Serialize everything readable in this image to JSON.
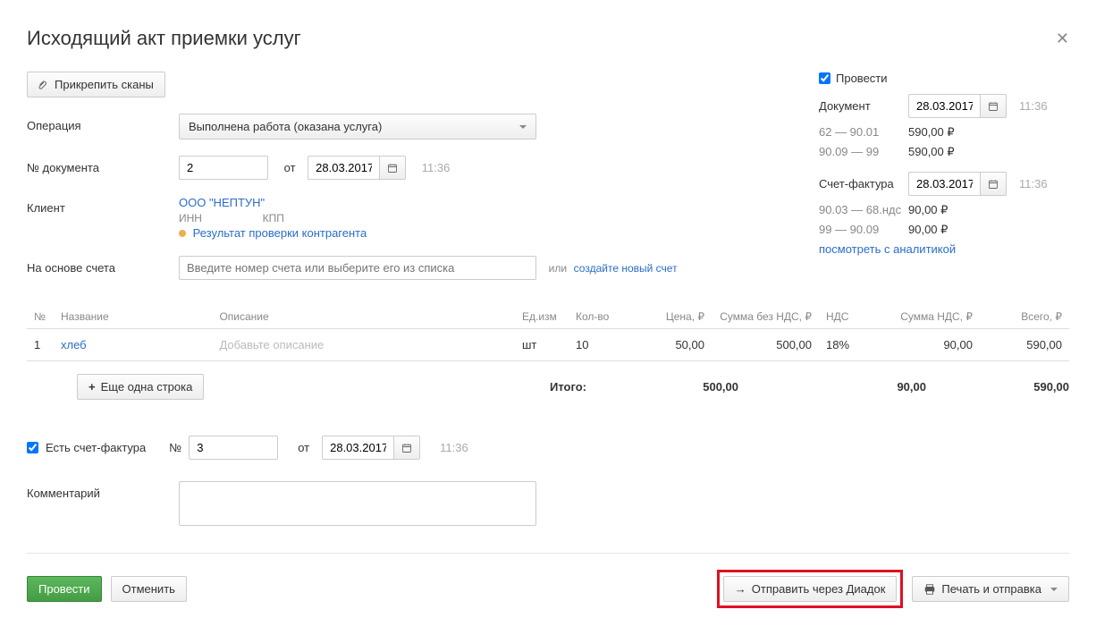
{
  "header": {
    "title": "Исходящий акт приемки услуг",
    "attach_scans": "Прикрепить сканы"
  },
  "left": {
    "operation_label": "Операция",
    "operation_value": "Выполнена работа (оказана услуга)",
    "doc_no_label": "№ документа",
    "doc_no": "2",
    "from_label": "от",
    "doc_date": "28.03.2017",
    "doc_time": "11:36",
    "client_label": "Клиент",
    "client_name": "ООО \"НЕПТУН\"",
    "inn_label": "ИНН",
    "kpp_label": "КПП",
    "check_result": "Результат проверки контрагента",
    "based_on_label": "На основе счета",
    "based_on_placeholder": "Введите номер счета или выберите его из списка",
    "or_label": "или",
    "create_new_invoice": "создайте новый счет"
  },
  "right": {
    "process_label": "Провести",
    "document_label": "Документ",
    "document_date": "28.03.2017",
    "document_time": "11:36",
    "acct1_left": "62 — 90.01",
    "acct1_right": "590,00 ₽",
    "acct2_left": "90.09 — 99",
    "acct2_right": "590,00 ₽",
    "invoice_label": "Счет-фактура",
    "invoice_date": "28.03.2017",
    "invoice_time": "11:36",
    "acct3_left": "90.03 — 68.ндс",
    "acct3_right": "90,00 ₽",
    "acct4_left": "99 — 90.09",
    "acct4_right": "90,00 ₽",
    "analytics": "посмотреть с аналитикой"
  },
  "table": {
    "headers": {
      "num": "№",
      "name": "Название",
      "desc": "Описание",
      "unit": "Ед.изм",
      "qty": "Кол-во",
      "price": "Цена, ₽",
      "sum_no_vat": "Сумма без НДС, ₽",
      "vat": "НДС",
      "vat_sum": "Сумма НДС, ₽",
      "total": "Всего, ₽"
    },
    "rows": [
      {
        "num": "1",
        "name": "хлеб",
        "desc_placeholder": "Добавьте описание",
        "unit": "шт",
        "qty": "10",
        "price": "50,00",
        "sum_no_vat": "500,00",
        "vat": "18%",
        "vat_sum": "90,00",
        "total": "590,00"
      }
    ],
    "add_row": "Еще одна строка",
    "totals_label": "Итого:",
    "total_sum_no_vat": "500,00",
    "total_vat_sum": "90,00",
    "total_total": "590,00"
  },
  "invoice_section": {
    "has_invoice": "Есть счет-фактура",
    "no_label": "№",
    "no_value": "3",
    "from_label": "от",
    "date": "28.03.2017",
    "time": "11:36"
  },
  "comment": {
    "label": "Комментарий"
  },
  "footer": {
    "process": "Провести",
    "cancel": "Отменить",
    "send_diadoc": "Отправить через Диадок",
    "print_send": "Печать и отправка"
  }
}
